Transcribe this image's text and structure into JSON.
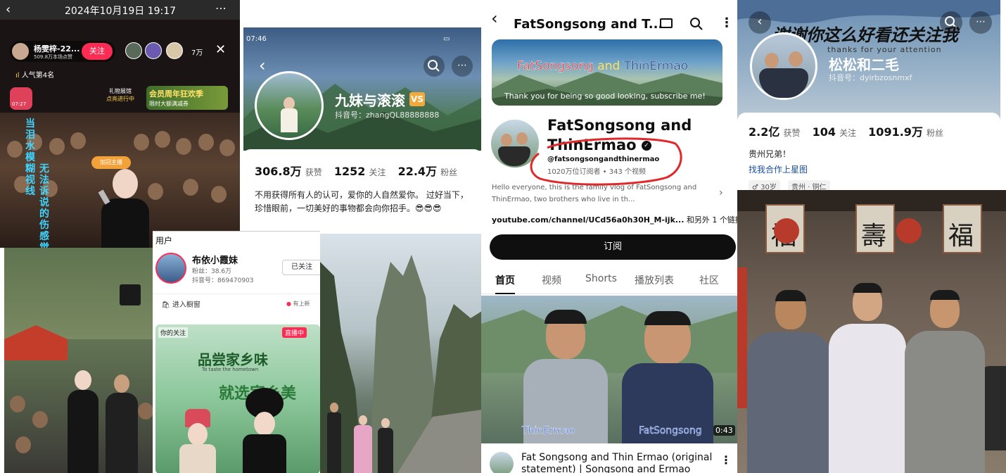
{
  "colors": {
    "douyin_red": "#fe2c55",
    "yt_black": "#0f0f0f",
    "yt_grey": "#606060",
    "link_blue": "#1a4fa0",
    "annotation_red": "#e0282a"
  },
  "p1": {
    "datetime": "2024年10月19日 19:17",
    "host_name": "杨雯梓-22...",
    "host_sub": "509.8万本场点赞",
    "follow_label": "关注",
    "viewer_count": "7万",
    "rank": "人气第4名",
    "gift_text": "礼物展馆",
    "gift_sub": "点亮进行中",
    "promo_title": "会员周年狂欢季",
    "promo_sub": "限时大额满减券",
    "badge_label": "加冠主播",
    "time_chip": "07:27",
    "vertical_text_1": "当泪水模糊视线",
    "vertical_text_2": "无法诉说的伤感觉"
  },
  "p2": {
    "status_time": "07:46",
    "name": "九妹与滚滚",
    "badge": "VS",
    "douyin_id": "抖音号：zhangQL88888888",
    "stats": [
      {
        "num": "306.8万",
        "label": "获赞"
      },
      {
        "num": "1252",
        "label": "关注"
      },
      {
        "num": "22.4万",
        "label": "粉丝"
      }
    ],
    "bio": "不用获得所有人的认可，爱你的人自然爱你。 过好当下，珍惜眼前，一切美好的事物都会向你招手。😎😎😎"
  },
  "p3": {
    "section": "用户",
    "name": "布依小霞妹",
    "fans": "粉丝：38.6万",
    "douyin_id": "抖音号：869470903",
    "followed": "已关注",
    "shop": "进入橱窗",
    "update": "有上新",
    "tag_following": "你的关注",
    "live_tag": "直播中",
    "thumb_title": "品尝家乡味",
    "thumb_sub": "To taste the hometown",
    "thumb_title2": "就选家乡美"
  },
  "p6": {
    "title": "FatSongsong and T...",
    "banner_title_1": "FatSongsong",
    "banner_title_and": "and",
    "banner_title_2": "ThinErmao",
    "banner_sub": "Thank you for being so good looking, subscribe me!",
    "channel_line1": "FatSongsong and",
    "channel_line2": "ThinErmao",
    "handle": "@fatsongsongandthinermao",
    "meta": "1020万位订阅者 • 343 个视频",
    "desc": "Hello everyone, this is the family vlog of FatSongsong and ThinErmao, two brothers who live in th...",
    "link": "youtube.com/channel/UCd56a0h30H_M-ijk...",
    "link_more": "和另外 1 个链接",
    "subscribe": "订阅",
    "tabs": [
      "首页",
      "视频",
      "Shorts",
      "播放列表",
      "社区"
    ],
    "video_label_left": "ThinErmao",
    "video_label_right": "FatSongsong",
    "duration": "0:43",
    "video_title_1": "Fat Songsong and Thin Ermao (original",
    "video_title_2": "statement) | Songsong and Ermao"
  },
  "p7": {
    "overlay_text": "谢谢你这么好看还关注我",
    "overlay_sub": "thanks for your attention",
    "name": "松松和二毛",
    "douyin_id": "抖音号：dyirbzosnmxf",
    "stats": [
      {
        "num": "2.2亿",
        "label": "获赞"
      },
      {
        "num": "104",
        "label": "关注"
      },
      {
        "num": "1091.9万",
        "label": "粉丝"
      }
    ],
    "bio": "贵州兄弟！",
    "link": "找我合作上星图",
    "tag_age": "♂ 30岁",
    "tag_loc": "贵州 · 铜仁"
  },
  "p8": {
    "sign_1": "福",
    "sign_2": "壽",
    "sign_3": "福"
  }
}
